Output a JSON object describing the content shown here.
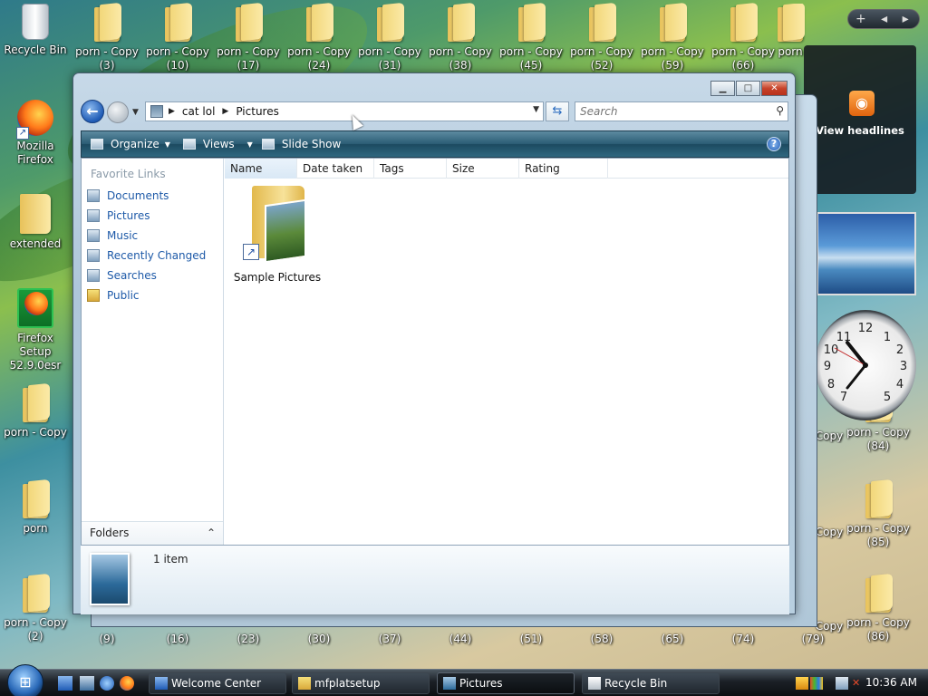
{
  "desktop": {
    "recycle_bin": "Recycle Bin",
    "top_folders": [
      "porn - Copy (3)",
      "porn - Copy (10)",
      "porn - Copy (17)",
      "porn - Copy (24)",
      "porn - Copy (31)",
      "porn - Copy (38)",
      "porn - Copy (45)",
      "porn - Copy (52)",
      "porn - Copy (59)",
      "porn - Copy (66)",
      "porn"
    ],
    "firefox": "Mozilla Firefox",
    "extended": "extended",
    "firefox_setup": "Firefox Setup 52.9.0esr",
    "porn_copy": "porn - Copy",
    "porn": "porn",
    "porn_copy_2": "porn - Copy (2)",
    "bottom_numbers": [
      "(9)",
      "(16)",
      "(23)",
      "(30)",
      "(37)",
      "(44)",
      "(51)",
      "(58)",
      "(65)",
      "(74)",
      "(79)"
    ],
    "right_partial": [
      "Copy",
      "porn - Copy (84)",
      "Copy",
      "porn - Copy (85)",
      "Copy",
      "porn - Copy (86)"
    ]
  },
  "sidebar": {
    "feed_headlines": "View headlines",
    "toolbar_glyphs": "+ ◂ ▸",
    "clock_numbers": [
      "12",
      "1",
      "2",
      "3",
      "4",
      "5",
      "7",
      "8",
      "9",
      "10",
      "11"
    ]
  },
  "explorer": {
    "breadcrumb": [
      "cat lol",
      "Pictures"
    ],
    "search_placeholder": "Search",
    "toolbar": {
      "organize": "Organize",
      "views": "Views",
      "slide_show": "Slide Show"
    },
    "favorite_links_header": "Favorite Links",
    "favorite_links": [
      "Documents",
      "Pictures",
      "Music",
      "Recently Changed",
      "Searches",
      "Public"
    ],
    "folders_label": "Folders",
    "columns": [
      "Name",
      "Date taken",
      "Tags",
      "Size",
      "Rating"
    ],
    "items": [
      {
        "label": "Sample Pictures"
      }
    ],
    "details_text": "1 item"
  },
  "taskbar": {
    "tasks": [
      "Welcome Center",
      "mfplatsetup",
      "Pictures",
      "Recycle Bin"
    ],
    "clock": "10:36 AM"
  },
  "colors": {
    "accent": "#2a5c74",
    "link": "#1e5aa8",
    "close": "#c7432a"
  }
}
